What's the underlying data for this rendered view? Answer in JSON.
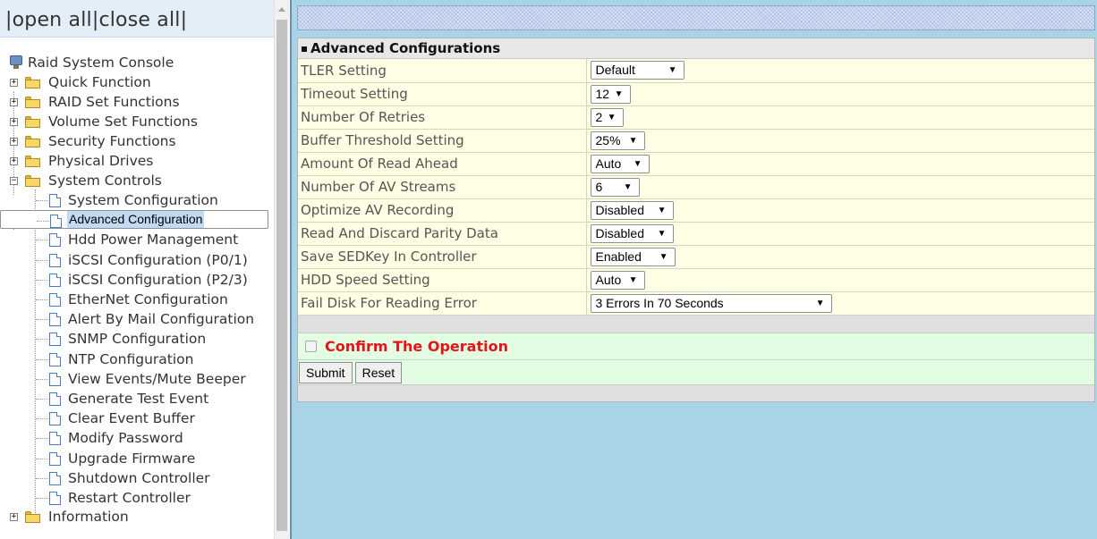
{
  "nav": {
    "open_all": "open all",
    "close_all": "close all",
    "sep": "|",
    "root": "Raid System Console",
    "folders": {
      "quick": "Quick Function",
      "raidset": "RAID Set Functions",
      "volumeset": "Volume Set Functions",
      "security": "Security Functions",
      "physical": "Physical Drives",
      "system": "System Controls",
      "information": "Information"
    },
    "system_items": [
      "System Configuration",
      "Advanced Configuration",
      "Hdd Power Management",
      "iSCSI Configuration (P0/1)",
      "iSCSI Configuration (P2/3)",
      "EtherNet Configuration",
      "Alert By Mail Configuration",
      "SNMP Configuration",
      "NTP Configuration",
      "View Events/Mute Beeper",
      "Generate Test Event",
      "Clear Event Buffer",
      "Modify Password",
      "Upgrade Firmware",
      "Shutdown Controller",
      "Restart Controller"
    ],
    "selected": "Advanced Configuration"
  },
  "form": {
    "title": "Advanced Configurations",
    "rows": [
      {
        "label": "TLER Setting",
        "value": "Default"
      },
      {
        "label": "Timeout Setting",
        "value": "12"
      },
      {
        "label": "Number Of Retries",
        "value": "2"
      },
      {
        "label": "Buffer Threshold Setting",
        "value": "25%"
      },
      {
        "label": "Amount Of Read Ahead",
        "value": "Auto"
      },
      {
        "label": "Number Of AV Streams",
        "value": "6"
      },
      {
        "label": "Optimize AV Recording",
        "value": "Disabled"
      },
      {
        "label": "Read And Discard Parity Data",
        "value": "Disabled"
      },
      {
        "label": "Save SEDKey In Controller",
        "value": "Enabled"
      },
      {
        "label": "HDD Speed Setting",
        "value": "Auto"
      },
      {
        "label": "Fail Disk For Reading Error",
        "value": "3 Errors In 70 Seconds"
      }
    ],
    "confirm_label": "Confirm The Operation",
    "confirm_checked": false,
    "submit": "Submit",
    "reset": "Reset"
  },
  "icons": {
    "expand": "plus-box-icon",
    "collapse": "minus-box-icon",
    "folder": "folder-icon",
    "page": "page-icon",
    "console": "console-icon",
    "dropdown": "dropdown-arrow-icon"
  },
  "colors": {
    "nav_header_bg": "#e3eef9",
    "selected_bg": "#c2daf2",
    "form_row_bg": "#ffffe5",
    "confirm_bg": "#e3fde3",
    "confirm_text": "#e4141b",
    "page_bg": "#a9d4e6"
  }
}
